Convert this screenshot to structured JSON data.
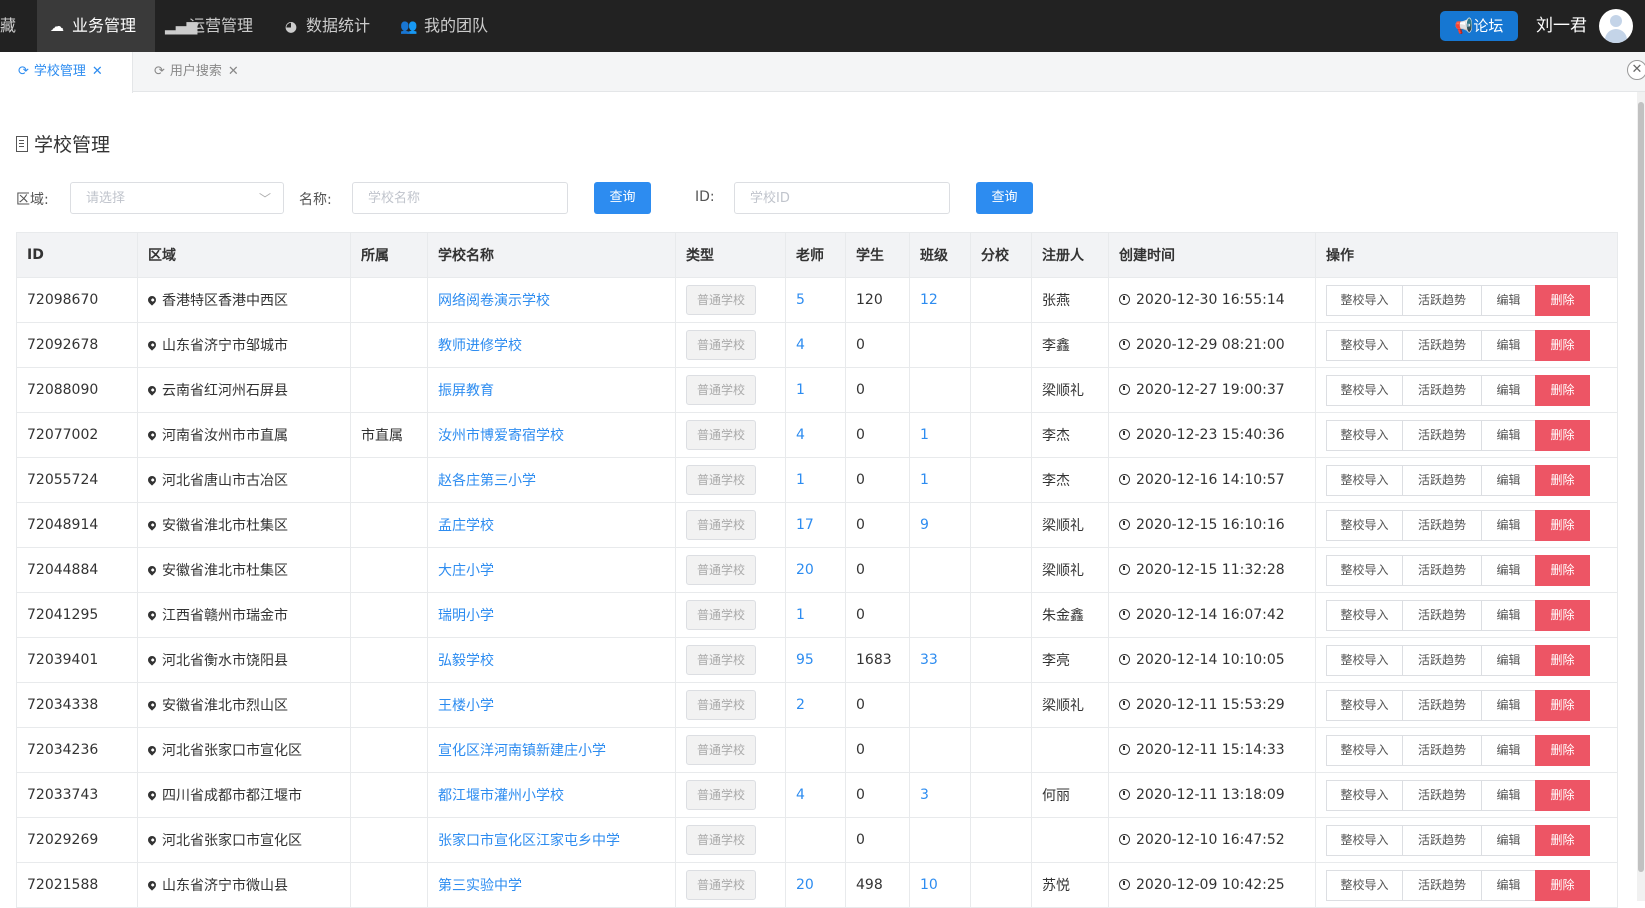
{
  "topnav": {
    "cut_label": "藏",
    "items": [
      {
        "label": "业务管理",
        "icon": "cloud-icon",
        "active": true
      },
      {
        "label": "运营管理",
        "icon": "signal-bars-icon",
        "active": false
      },
      {
        "label": "数据统计",
        "icon": "pie-chart-icon",
        "active": false
      },
      {
        "label": "我的团队",
        "icon": "users-icon",
        "active": false
      }
    ],
    "forum_label": "论坛",
    "user_name": "刘一君"
  },
  "tabs": [
    {
      "label": "学校管理",
      "active": true
    },
    {
      "label": "用户搜索",
      "active": false
    }
  ],
  "page_title": "学校管理",
  "filters": {
    "region_label": "区域:",
    "region_placeholder": "请选择",
    "name_label": "名称:",
    "name_placeholder": "学校名称",
    "query_label": "查询",
    "id_label": "ID:",
    "id_placeholder": "学校ID",
    "query2_label": "查询"
  },
  "table": {
    "columns": [
      "ID",
      "区域",
      "所属",
      "学校名称",
      "类型",
      "老师",
      "学生",
      "班级",
      "分校",
      "注册人",
      "创建时间",
      "操作"
    ],
    "actions": [
      "整校导入",
      "活跃趋势",
      "编辑",
      "删除"
    ],
    "rows": [
      {
        "id": "72098670",
        "region": "香港特区香港中西区",
        "belong": "",
        "name": "网络阅卷演示学校",
        "type": "普通学校",
        "teachers": "5",
        "students": "120",
        "classes": "12",
        "branch": "",
        "registrar": "张燕",
        "created": "2020-12-30 16:55:14"
      },
      {
        "id": "72092678",
        "region": "山东省济宁市邹城市",
        "belong": "",
        "name": "教师进修学校",
        "type": "普通学校",
        "teachers": "4",
        "students": "0",
        "classes": "",
        "branch": "",
        "registrar": "李鑫",
        "created": "2020-12-29 08:21:00"
      },
      {
        "id": "72088090",
        "region": "云南省红河州石屏县",
        "belong": "",
        "name": "振屏教育",
        "type": "普通学校",
        "teachers": "1",
        "students": "0",
        "classes": "",
        "branch": "",
        "registrar": "梁顺礼",
        "created": "2020-12-27 19:00:37"
      },
      {
        "id": "72077002",
        "region": "河南省汝州市市直属",
        "belong": "市直属",
        "name": "汝州市博爱寄宿学校",
        "type": "普通学校",
        "teachers": "4",
        "students": "0",
        "classes": "1",
        "branch": "",
        "registrar": "李杰",
        "created": "2020-12-23 15:40:36"
      },
      {
        "id": "72055724",
        "region": "河北省唐山市古冶区",
        "belong": "",
        "name": "赵各庄第三小学",
        "type": "普通学校",
        "teachers": "1",
        "students": "0",
        "classes": "1",
        "branch": "",
        "registrar": "李杰",
        "created": "2020-12-16 14:10:57"
      },
      {
        "id": "72048914",
        "region": "安徽省淮北市杜集区",
        "belong": "",
        "name": "孟庄学校",
        "type": "普通学校",
        "teachers": "17",
        "students": "0",
        "classes": "9",
        "branch": "",
        "registrar": "梁顺礼",
        "created": "2020-12-15 16:10:16"
      },
      {
        "id": "72044884",
        "region": "安徽省淮北市杜集区",
        "belong": "",
        "name": "大庄小学",
        "type": "普通学校",
        "teachers": "20",
        "students": "0",
        "classes": "",
        "branch": "",
        "registrar": "梁顺礼",
        "created": "2020-12-15 11:32:28"
      },
      {
        "id": "72041295",
        "region": "江西省赣州市瑞金市",
        "belong": "",
        "name": "瑞明小学",
        "type": "普通学校",
        "teachers": "1",
        "students": "0",
        "classes": "",
        "branch": "",
        "registrar": "朱金鑫",
        "created": "2020-12-14 16:07:42"
      },
      {
        "id": "72039401",
        "region": "河北省衡水市饶阳县",
        "belong": "",
        "name": "弘毅学校",
        "type": "普通学校",
        "teachers": "95",
        "students": "1683",
        "classes": "33",
        "branch": "",
        "registrar": "李亮",
        "created": "2020-12-14 10:10:05"
      },
      {
        "id": "72034338",
        "region": "安徽省淮北市烈山区",
        "belong": "",
        "name": "王楼小学",
        "type": "普通学校",
        "teachers": "2",
        "students": "0",
        "classes": "",
        "branch": "",
        "registrar": "梁顺礼",
        "created": "2020-12-11 15:53:29"
      },
      {
        "id": "72034236",
        "region": "河北省张家口市宣化区",
        "belong": "",
        "name": "宣化区洋河南镇新建庄小学",
        "type": "普通学校",
        "teachers": "",
        "students": "0",
        "classes": "",
        "branch": "",
        "registrar": "",
        "created": "2020-12-11 15:14:33"
      },
      {
        "id": "72033743",
        "region": "四川省成都市都江堰市",
        "belong": "",
        "name": "都江堰市灌州小学校",
        "type": "普通学校",
        "teachers": "4",
        "students": "0",
        "classes": "3",
        "branch": "",
        "registrar": "何丽",
        "created": "2020-12-11 13:18:09"
      },
      {
        "id": "72029269",
        "region": "河北省张家口市宣化区",
        "belong": "",
        "name": "张家口市宣化区江家屯乡中学",
        "type": "普通学校",
        "teachers": "",
        "students": "0",
        "classes": "",
        "branch": "",
        "registrar": "",
        "created": "2020-12-10 16:47:52"
      },
      {
        "id": "72021588",
        "region": "山东省济宁市微山县",
        "belong": "",
        "name": "第三实验中学",
        "type": "普通学校",
        "teachers": "20",
        "students": "498",
        "classes": "10",
        "branch": "",
        "registrar": "苏悦",
        "created": "2020-12-09 10:42:25"
      }
    ]
  },
  "colors": {
    "accent": "#2d8cf0",
    "danger": "#ed5565",
    "nav_bg": "#222222",
    "forum": "#1677d2"
  }
}
